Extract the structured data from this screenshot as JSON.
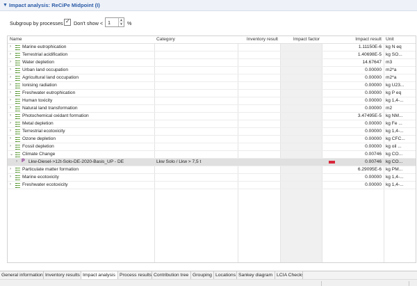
{
  "section": {
    "title": "Impact analysis: ReCiPe Midpoint (I)"
  },
  "toolbar": {
    "subgroup_label": "Subgroup by processes",
    "subgroup_checked": true,
    "dont_show_label": "Don't show <",
    "threshold_value": "1",
    "percent_label": "%"
  },
  "table": {
    "columns": {
      "name": "Name",
      "category": "Category",
      "inventory_result": "Inventory result",
      "impact_factor": "Impact factor",
      "impact_result": "Impact result",
      "unit": "Unit"
    },
    "rows": [
      {
        "name": "Marine eutrophication",
        "category": "",
        "impact_result": "1.11150E-6",
        "unit": "kg N eq",
        "kind": "category",
        "expanded": false
      },
      {
        "name": "Terrestrial acidification",
        "category": "",
        "impact_result": "1.40698E-5",
        "unit": "kg SO...",
        "kind": "category",
        "expanded": false
      },
      {
        "name": "Water depletion",
        "category": "",
        "impact_result": "14.67647",
        "unit": "m3",
        "kind": "category",
        "expanded": false
      },
      {
        "name": "Urban land occupation",
        "category": "",
        "impact_result": "0.00000",
        "unit": "m2*a",
        "kind": "category",
        "expanded": false
      },
      {
        "name": "Agricultural land occupation",
        "category": "",
        "impact_result": "0.00000",
        "unit": "m2*a",
        "kind": "category",
        "expanded": false
      },
      {
        "name": "Ionising radiation",
        "category": "",
        "impact_result": "0.00000",
        "unit": "kg U23...",
        "kind": "category",
        "expanded": false
      },
      {
        "name": "Freshwater eutrophication",
        "category": "",
        "impact_result": "0.00000",
        "unit": "kg P eq",
        "kind": "category",
        "expanded": false
      },
      {
        "name": "Human toxicity",
        "category": "",
        "impact_result": "0.00000",
        "unit": "kg 1,4-...",
        "kind": "category",
        "expanded": false
      },
      {
        "name": "Natural land transformation",
        "category": "",
        "impact_result": "0.00000",
        "unit": "m2",
        "kind": "category",
        "expanded": false
      },
      {
        "name": "Photochemical oxidant formation",
        "category": "",
        "impact_result": "3.47495E-5",
        "unit": "kg NM...",
        "kind": "category",
        "expanded": false
      },
      {
        "name": "Metal depletion",
        "category": "",
        "impact_result": "0.00000",
        "unit": "kg Fe ...",
        "kind": "category",
        "expanded": false
      },
      {
        "name": "Terrestrial ecotoxicity",
        "category": "",
        "impact_result": "0.00000",
        "unit": "kg 1,4-...",
        "kind": "category",
        "expanded": false
      },
      {
        "name": "Ozone depletion",
        "category": "",
        "impact_result": "0.00000",
        "unit": "kg CFC...",
        "kind": "category",
        "expanded": false
      },
      {
        "name": "Fossil depletion",
        "category": "",
        "impact_result": "0.00000",
        "unit": "kg oil ...",
        "kind": "category",
        "expanded": false
      },
      {
        "name": "Climate Change",
        "category": "",
        "impact_result": "0.00746",
        "unit": "kg CO...",
        "kind": "category",
        "expanded": true
      },
      {
        "name": "Lkw-Diesel->12t-Solo-DE-2020-Basis_UP - DE",
        "category": "Lkw Solo / Lkw > 7,5 t",
        "impact_result": "0.00746",
        "unit": "kg CO...",
        "kind": "process",
        "selected": true,
        "contribution_fraction": 1.0
      },
      {
        "name": "Particulate matter formation",
        "category": "",
        "impact_result": "6.29095E-6",
        "unit": "kg PM...",
        "kind": "category",
        "expanded": false
      },
      {
        "name": "Marine ecotoxicity",
        "category": "",
        "impact_result": "0.00000",
        "unit": "kg 1,4-...",
        "kind": "category",
        "expanded": false
      },
      {
        "name": "Freshwater ecotoxicity",
        "category": "",
        "impact_result": "0.00000",
        "unit": "kg 1,4-...",
        "kind": "category",
        "expanded": false
      }
    ]
  },
  "tabs": [
    {
      "label": "General information",
      "active": false
    },
    {
      "label": "Inventory results",
      "active": false
    },
    {
      "label": "Impact analysis",
      "active": true
    },
    {
      "label": "Process results",
      "active": false
    },
    {
      "label": "Contribution tree",
      "active": false
    },
    {
      "label": "Grouping",
      "active": false
    },
    {
      "label": "Locations",
      "active": false
    },
    {
      "label": "Sankey diagram",
      "active": false
    },
    {
      "label": "LCIA Checks",
      "active": false
    }
  ],
  "colors": {
    "header_text": "#2b5aa7",
    "category_icon": "#6aa842",
    "process_icon": "#8a2c8e",
    "contribution_bar": "#d8263a",
    "selected_row": "#e0e0e0"
  }
}
